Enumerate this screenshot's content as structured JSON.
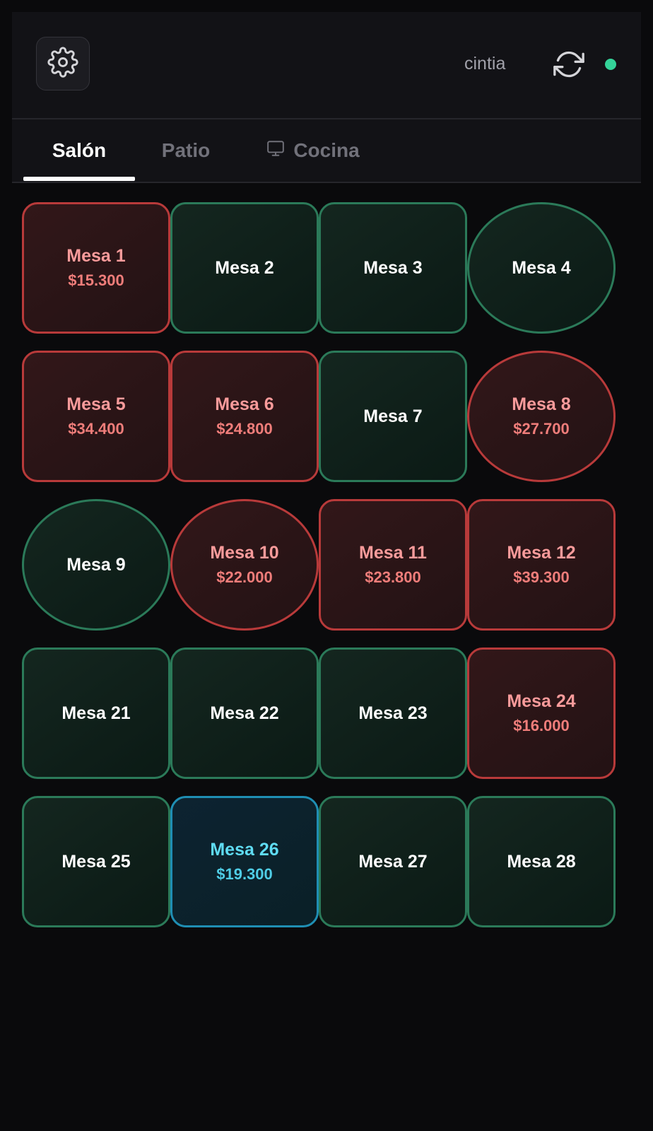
{
  "header": {
    "user": "cintia",
    "status_color": "#34d399",
    "settings_icon": "gear-icon",
    "refresh_icon": "refresh-icon"
  },
  "tabs": [
    {
      "label": "Salón",
      "active": true
    },
    {
      "label": "Patio",
      "active": false
    },
    {
      "label": "Cocina",
      "active": false,
      "icon": "monitor-icon"
    }
  ],
  "tables": [
    {
      "name": "Mesa 1",
      "amount": "$15.300",
      "status": "busy",
      "shape": "square"
    },
    {
      "name": "Mesa 2",
      "amount": "",
      "status": "free",
      "shape": "square"
    },
    {
      "name": "Mesa 3",
      "amount": "",
      "status": "free",
      "shape": "square"
    },
    {
      "name": "Mesa 4",
      "amount": "",
      "status": "free",
      "shape": "round"
    },
    {
      "name": "Mesa 5",
      "amount": "$34.400",
      "status": "busy",
      "shape": "square"
    },
    {
      "name": "Mesa 6",
      "amount": "$24.800",
      "status": "busy",
      "shape": "square"
    },
    {
      "name": "Mesa 7",
      "amount": "",
      "status": "free",
      "shape": "square"
    },
    {
      "name": "Mesa 8",
      "amount": "$27.700",
      "status": "busy",
      "shape": "round"
    },
    {
      "name": "Mesa 9",
      "amount": "",
      "status": "free",
      "shape": "round"
    },
    {
      "name": "Mesa 10",
      "amount": "$22.000",
      "status": "busy",
      "shape": "round"
    },
    {
      "name": "Mesa 11",
      "amount": "$23.800",
      "status": "busy",
      "shape": "square"
    },
    {
      "name": "Mesa 12",
      "amount": "$39.300",
      "status": "busy",
      "shape": "square"
    },
    {
      "name": "Mesa 21",
      "amount": "",
      "status": "free",
      "shape": "square"
    },
    {
      "name": "Mesa 22",
      "amount": "",
      "status": "free",
      "shape": "square"
    },
    {
      "name": "Mesa 23",
      "amount": "",
      "status": "free",
      "shape": "square"
    },
    {
      "name": "Mesa 24",
      "amount": "$16.000",
      "status": "busy",
      "shape": "square"
    },
    {
      "name": "Mesa 25",
      "amount": "",
      "status": "free",
      "shape": "square"
    },
    {
      "name": "Mesa 26",
      "amount": "$19.300",
      "status": "selected",
      "shape": "square"
    },
    {
      "name": "Mesa 27",
      "amount": "",
      "status": "free",
      "shape": "square"
    },
    {
      "name": "Mesa 28",
      "amount": "",
      "status": "free",
      "shape": "square"
    }
  ],
  "colors": {
    "free_border": "#2b7a59",
    "busy_border": "#b83a3a",
    "busy_text": "#f99b9b",
    "selected_border": "#1f8eb3",
    "selected_text": "#5fdcf3"
  }
}
